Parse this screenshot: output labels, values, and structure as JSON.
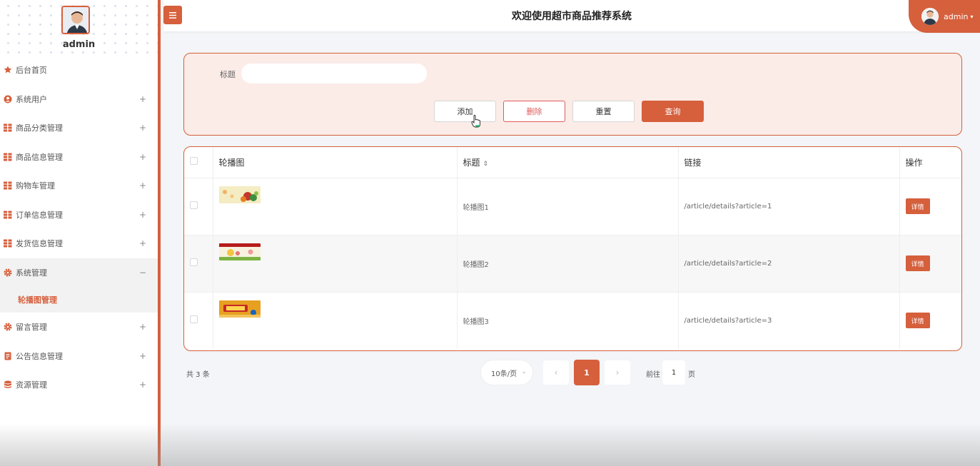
{
  "sidebar": {
    "username": "admin",
    "items": [
      {
        "label": "后台首页",
        "toggle": ""
      },
      {
        "label": "系统用户",
        "toggle": "+"
      },
      {
        "label": "商品分类管理",
        "toggle": "+"
      },
      {
        "label": "商品信息管理",
        "toggle": "+"
      },
      {
        "label": "购物车管理",
        "toggle": "+"
      },
      {
        "label": "订单信息管理",
        "toggle": "+"
      },
      {
        "label": "发货信息管理",
        "toggle": "+"
      },
      {
        "label": "系统管理",
        "toggle": "−",
        "submenu": "轮播图管理"
      },
      {
        "label": "留言管理",
        "toggle": "+"
      },
      {
        "label": "公告信息管理",
        "toggle": "+"
      },
      {
        "label": "资源管理",
        "toggle": "+"
      }
    ]
  },
  "header": {
    "title": "欢迎使用超市商品推荐系统",
    "user_label": "admin"
  },
  "search": {
    "label": "标题",
    "value": "",
    "placeholder": "",
    "add_label": "添加",
    "delete_label": "删除",
    "reset_label": "重置",
    "query_label": "查询"
  },
  "table": {
    "columns": [
      "轮播图",
      "标题",
      "链接",
      "操作"
    ],
    "rows": [
      {
        "title": "轮播图1",
        "link": "/article/details?article=1",
        "action": "详情"
      },
      {
        "title": "轮播图2",
        "link": "/article/details?article=2",
        "action": "详情"
      },
      {
        "title": "轮播图3",
        "link": "/article/details?article=3",
        "action": "详情"
      }
    ]
  },
  "pagination": {
    "total": "共 3 条",
    "page_size": "10条/页",
    "current_page": "1",
    "goto_label": "前往",
    "goto_value": "1",
    "page_suffix": "页"
  },
  "colors": {
    "accent": "#d65f3c",
    "danger": "#e05a5a",
    "panel_bg": "#fbece8"
  }
}
